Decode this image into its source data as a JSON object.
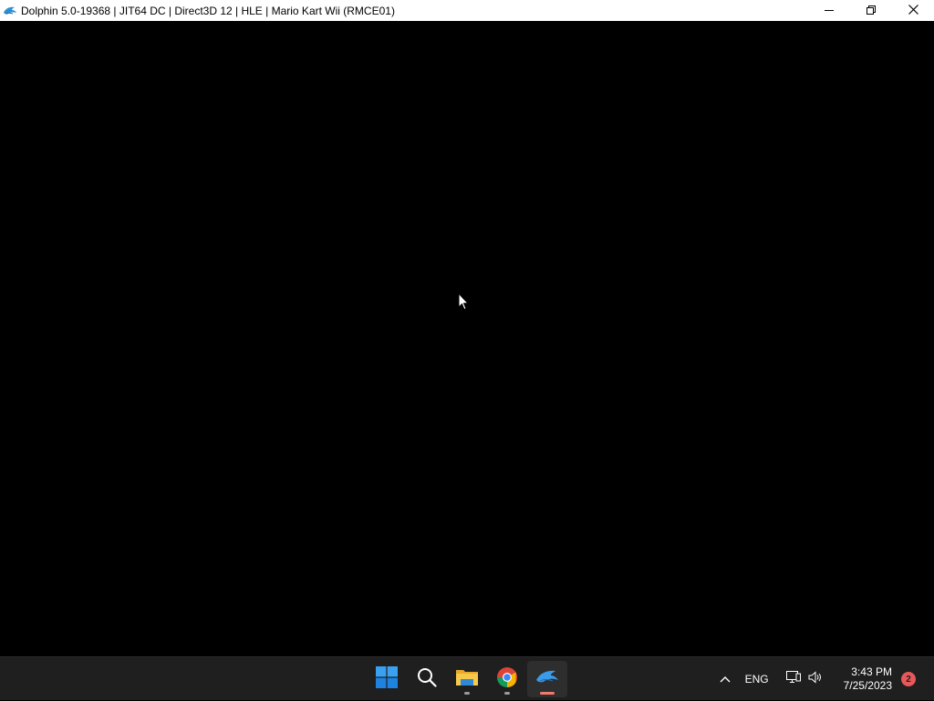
{
  "window": {
    "title": "Dolphin 5.0-19368 | JIT64 DC | Direct3D 12 | HLE | Mario Kart Wii (RMCE01)",
    "icon": "dolphin-icon",
    "controls": [
      "minimize-icon",
      "restore-icon",
      "close-icon"
    ]
  },
  "taskbar": {
    "apps": [
      {
        "name": "Start",
        "icon": "windows-start-icon"
      },
      {
        "name": "Search",
        "icon": "search-icon"
      },
      {
        "name": "File Explorer",
        "icon": "folder-icon",
        "running": true
      },
      {
        "name": "Google Chrome",
        "icon": "chrome-icon",
        "running": true
      },
      {
        "name": "Dolphin",
        "icon": "dolphin-icon",
        "running": true,
        "active": true
      }
    ],
    "tray": {
      "language": "ENG",
      "time": "3:43 PM",
      "date": "7/25/2023",
      "notification_count": "2"
    }
  },
  "colors": {
    "titlebar_bg": "#ffffff",
    "render_bg": "#000000",
    "taskbar_bg": "#1f1f1f",
    "active_indicator": "#f07a6b",
    "notification_badge": "#e8585a"
  }
}
